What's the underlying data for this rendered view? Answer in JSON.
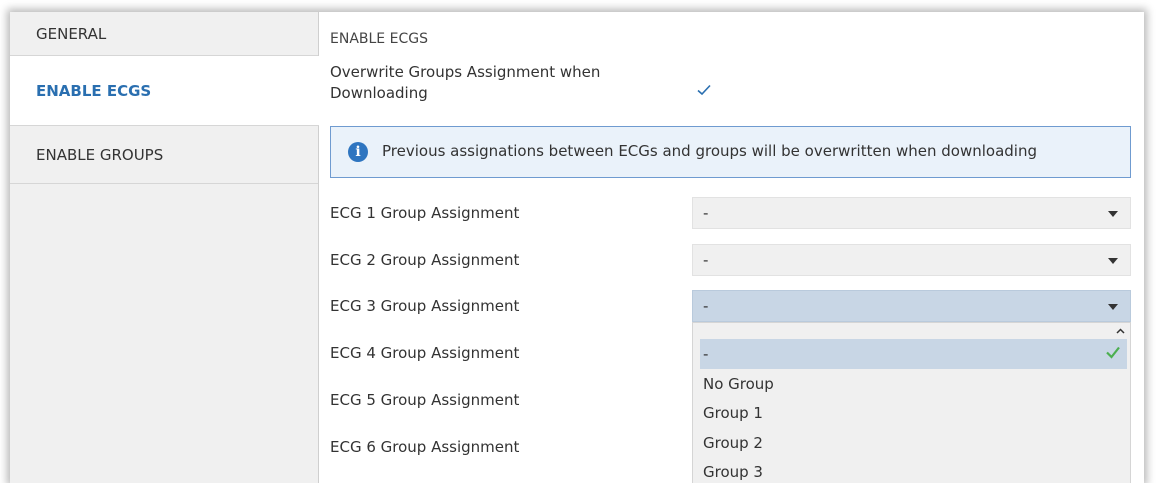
{
  "sidebar": {
    "items": [
      {
        "label": "GENERAL"
      },
      {
        "label": "ENABLE ECGS"
      },
      {
        "label": "ENABLE GROUPS"
      }
    ]
  },
  "content": {
    "section_title": "ENABLE ECGS",
    "overwrite": {
      "label": "Overwrite Groups Assignment when Downloading",
      "checked": true
    },
    "info_text": "Previous assignations between ECGs and groups will be overwritten when downloading",
    "rows": [
      {
        "label": "ECG 1 Group Assignment",
        "value": "-"
      },
      {
        "label": "ECG 2 Group Assignment",
        "value": "-"
      },
      {
        "label": "ECG 3 Group Assignment",
        "value": "-"
      },
      {
        "label": "ECG 4 Group Assignment"
      },
      {
        "label": "ECG 5 Group Assignment"
      },
      {
        "label": "ECG 6 Group Assignment"
      }
    ],
    "dropdown_options": [
      "-",
      "No Group",
      "Group 1",
      "Group 2",
      "Group 3"
    ]
  },
  "colors": {
    "accent": "#2a6fb0",
    "info_border": "#6f9bd0",
    "check": "#4caf50"
  }
}
